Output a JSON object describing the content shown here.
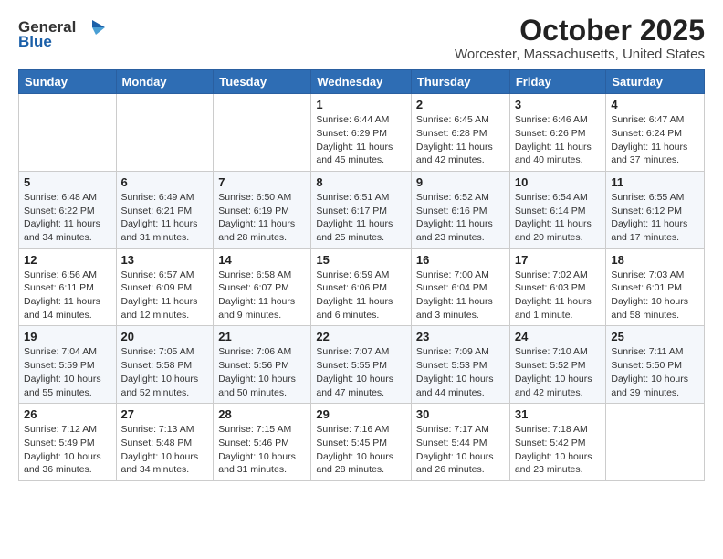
{
  "header": {
    "logo_general": "General",
    "logo_blue": "Blue",
    "title": "October 2025",
    "subtitle": "Worcester, Massachusetts, United States"
  },
  "days_of_week": [
    "Sunday",
    "Monday",
    "Tuesday",
    "Wednesday",
    "Thursday",
    "Friday",
    "Saturday"
  ],
  "weeks": [
    [
      {
        "day": "",
        "info": ""
      },
      {
        "day": "",
        "info": ""
      },
      {
        "day": "",
        "info": ""
      },
      {
        "day": "1",
        "info": "Sunrise: 6:44 AM\nSunset: 6:29 PM\nDaylight: 11 hours\nand 45 minutes."
      },
      {
        "day": "2",
        "info": "Sunrise: 6:45 AM\nSunset: 6:28 PM\nDaylight: 11 hours\nand 42 minutes."
      },
      {
        "day": "3",
        "info": "Sunrise: 6:46 AM\nSunset: 6:26 PM\nDaylight: 11 hours\nand 40 minutes."
      },
      {
        "day": "4",
        "info": "Sunrise: 6:47 AM\nSunset: 6:24 PM\nDaylight: 11 hours\nand 37 minutes."
      }
    ],
    [
      {
        "day": "5",
        "info": "Sunrise: 6:48 AM\nSunset: 6:22 PM\nDaylight: 11 hours\nand 34 minutes."
      },
      {
        "day": "6",
        "info": "Sunrise: 6:49 AM\nSunset: 6:21 PM\nDaylight: 11 hours\nand 31 minutes."
      },
      {
        "day": "7",
        "info": "Sunrise: 6:50 AM\nSunset: 6:19 PM\nDaylight: 11 hours\nand 28 minutes."
      },
      {
        "day": "8",
        "info": "Sunrise: 6:51 AM\nSunset: 6:17 PM\nDaylight: 11 hours\nand 25 minutes."
      },
      {
        "day": "9",
        "info": "Sunrise: 6:52 AM\nSunset: 6:16 PM\nDaylight: 11 hours\nand 23 minutes."
      },
      {
        "day": "10",
        "info": "Sunrise: 6:54 AM\nSunset: 6:14 PM\nDaylight: 11 hours\nand 20 minutes."
      },
      {
        "day": "11",
        "info": "Sunrise: 6:55 AM\nSunset: 6:12 PM\nDaylight: 11 hours\nand 17 minutes."
      }
    ],
    [
      {
        "day": "12",
        "info": "Sunrise: 6:56 AM\nSunset: 6:11 PM\nDaylight: 11 hours\nand 14 minutes."
      },
      {
        "day": "13",
        "info": "Sunrise: 6:57 AM\nSunset: 6:09 PM\nDaylight: 11 hours\nand 12 minutes."
      },
      {
        "day": "14",
        "info": "Sunrise: 6:58 AM\nSunset: 6:07 PM\nDaylight: 11 hours\nand 9 minutes."
      },
      {
        "day": "15",
        "info": "Sunrise: 6:59 AM\nSunset: 6:06 PM\nDaylight: 11 hours\nand 6 minutes."
      },
      {
        "day": "16",
        "info": "Sunrise: 7:00 AM\nSunset: 6:04 PM\nDaylight: 11 hours\nand 3 minutes."
      },
      {
        "day": "17",
        "info": "Sunrise: 7:02 AM\nSunset: 6:03 PM\nDaylight: 11 hours\nand 1 minute."
      },
      {
        "day": "18",
        "info": "Sunrise: 7:03 AM\nSunset: 6:01 PM\nDaylight: 10 hours\nand 58 minutes."
      }
    ],
    [
      {
        "day": "19",
        "info": "Sunrise: 7:04 AM\nSunset: 5:59 PM\nDaylight: 10 hours\nand 55 minutes."
      },
      {
        "day": "20",
        "info": "Sunrise: 7:05 AM\nSunset: 5:58 PM\nDaylight: 10 hours\nand 52 minutes."
      },
      {
        "day": "21",
        "info": "Sunrise: 7:06 AM\nSunset: 5:56 PM\nDaylight: 10 hours\nand 50 minutes."
      },
      {
        "day": "22",
        "info": "Sunrise: 7:07 AM\nSunset: 5:55 PM\nDaylight: 10 hours\nand 47 minutes."
      },
      {
        "day": "23",
        "info": "Sunrise: 7:09 AM\nSunset: 5:53 PM\nDaylight: 10 hours\nand 44 minutes."
      },
      {
        "day": "24",
        "info": "Sunrise: 7:10 AM\nSunset: 5:52 PM\nDaylight: 10 hours\nand 42 minutes."
      },
      {
        "day": "25",
        "info": "Sunrise: 7:11 AM\nSunset: 5:50 PM\nDaylight: 10 hours\nand 39 minutes."
      }
    ],
    [
      {
        "day": "26",
        "info": "Sunrise: 7:12 AM\nSunset: 5:49 PM\nDaylight: 10 hours\nand 36 minutes."
      },
      {
        "day": "27",
        "info": "Sunrise: 7:13 AM\nSunset: 5:48 PM\nDaylight: 10 hours\nand 34 minutes."
      },
      {
        "day": "28",
        "info": "Sunrise: 7:15 AM\nSunset: 5:46 PM\nDaylight: 10 hours\nand 31 minutes."
      },
      {
        "day": "29",
        "info": "Sunrise: 7:16 AM\nSunset: 5:45 PM\nDaylight: 10 hours\nand 28 minutes."
      },
      {
        "day": "30",
        "info": "Sunrise: 7:17 AM\nSunset: 5:44 PM\nDaylight: 10 hours\nand 26 minutes."
      },
      {
        "day": "31",
        "info": "Sunrise: 7:18 AM\nSunset: 5:42 PM\nDaylight: 10 hours\nand 23 minutes."
      },
      {
        "day": "",
        "info": ""
      }
    ]
  ]
}
